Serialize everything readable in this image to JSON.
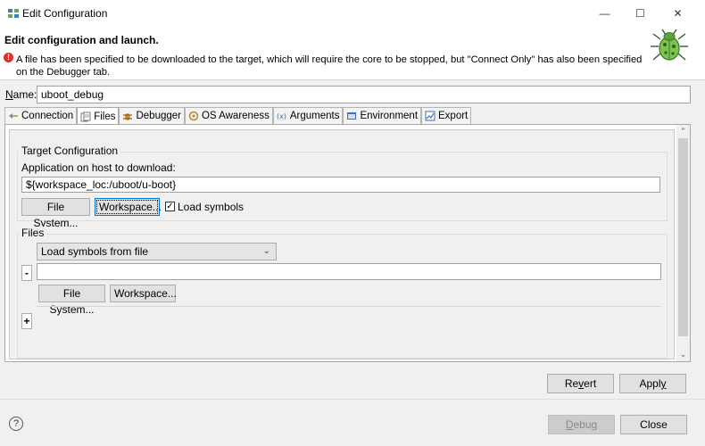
{
  "window": {
    "title": "Edit Configuration",
    "controls": {
      "minimize": "—",
      "maximize": "☐",
      "close": "✕"
    }
  },
  "header": {
    "title": "Edit configuration and launch.",
    "error_message": "A file has been specified to be downloaded to the target, which will require the core to be stopped, but \"Connect Only\" has also been specified on the Debugger tab.",
    "error_icon": "!"
  },
  "name": {
    "label": "Name:",
    "value": "uboot_debug"
  },
  "tabs": [
    {
      "label": "Connection",
      "icon": "connection-icon",
      "active": false
    },
    {
      "label": "Files",
      "icon": "files-icon",
      "active": true
    },
    {
      "label": "Debugger",
      "icon": "debugger-icon",
      "active": false
    },
    {
      "label": "OS Awareness",
      "icon": "os-awareness-icon",
      "active": false
    },
    {
      "label": "Arguments",
      "icon": "arguments-icon",
      "active": false
    },
    {
      "label": "Environment",
      "icon": "environment-icon",
      "active": false
    },
    {
      "label": "Export",
      "icon": "export-icon",
      "active": false
    }
  ],
  "target_config": {
    "group_label": "Target Configuration",
    "app_label": "Application on host to download:",
    "app_path": "${workspace_loc:/uboot/u-boot}",
    "file_system_button": "File System...",
    "workspace_button": "Workspace...",
    "load_symbols_label": "Load symbols",
    "load_symbols_checked": "✓"
  },
  "files": {
    "group_label": "Files",
    "select_value": "Load symbols from file",
    "remove_button": "-",
    "file_path": "",
    "file_system_button": "File System...",
    "workspace_button": "Workspace...",
    "add_button": "+"
  },
  "buttons": {
    "revert_pre": "Re",
    "revert_u": "v",
    "revert_post": "ert",
    "apply_pre": "Appl",
    "apply_u": "y",
    "apply_post": "",
    "debug_u": "D",
    "debug_post": "ebug",
    "close": "Close"
  },
  "help_icon": "?",
  "colors": {
    "error": "#d9342b",
    "focus": "#0078d7",
    "background": "#f0f0f0"
  }
}
